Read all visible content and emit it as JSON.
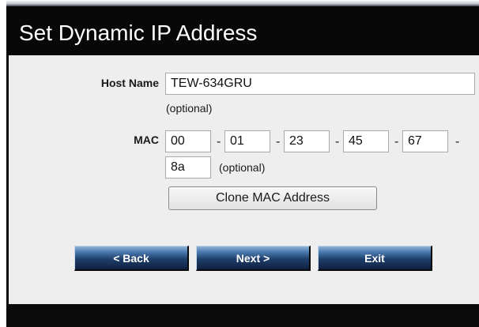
{
  "page": {
    "title": "Set Dynamic IP Address"
  },
  "form": {
    "host_name_label": "Host Name",
    "host_name_value": "TEW-634GRU",
    "host_name_hint": "(optional)",
    "mac_label": "MAC",
    "mac_octets": [
      "00",
      "01",
      "23",
      "45",
      "67",
      "8a"
    ],
    "mac_separator": "-",
    "mac_hint": "(optional)",
    "clone_mac_label": "Clone MAC Address"
  },
  "nav": {
    "back_label": "< Back",
    "next_label": "Next >",
    "exit_label": "Exit"
  },
  "colors": {
    "title_bar": "#080808",
    "panel": "#eeeeee",
    "nav_button": "#1f3f6c"
  }
}
